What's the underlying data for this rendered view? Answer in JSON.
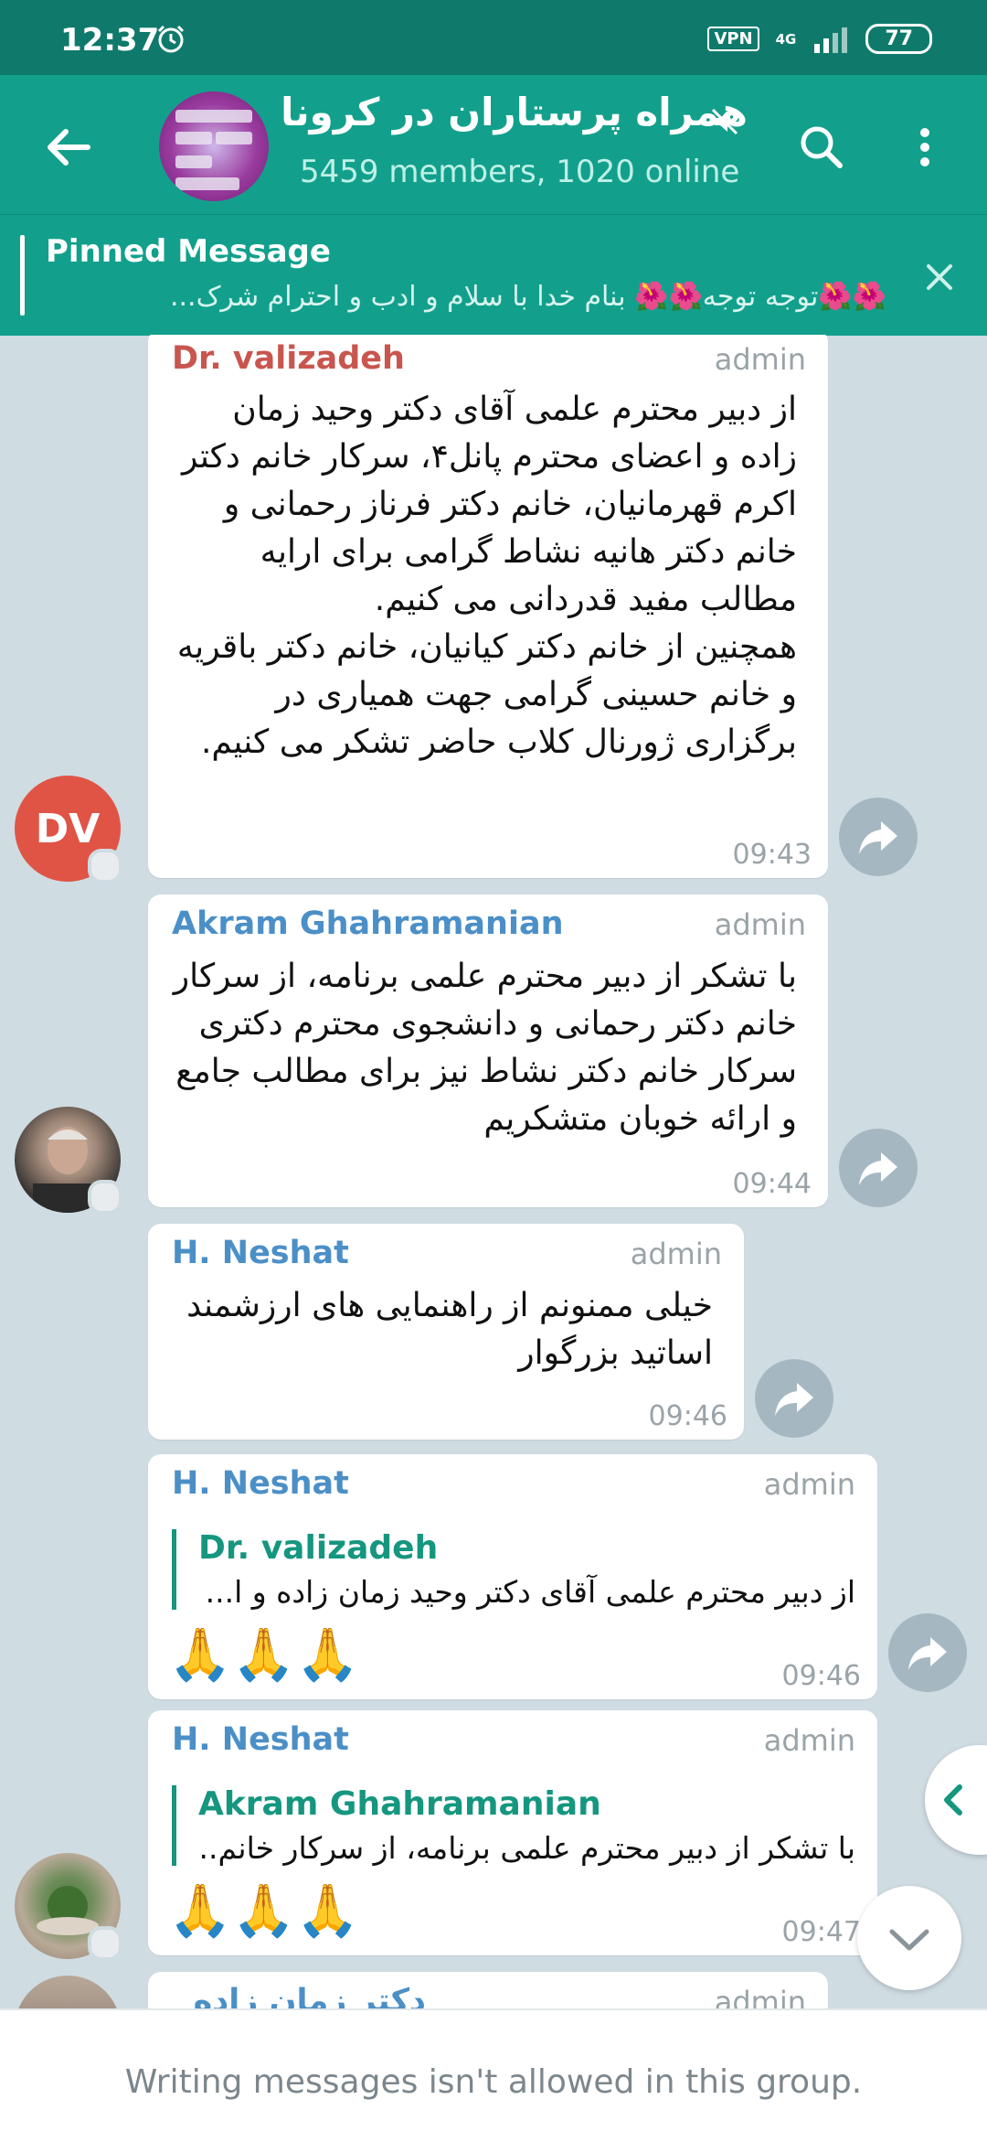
{
  "status": {
    "time": "12:37",
    "vpn": "VPN",
    "network": "4G",
    "battery": "77"
  },
  "header": {
    "title": "همراه پرستاران در کرونا",
    "subtitle": "5459 members, 1020 online"
  },
  "pinned": {
    "label": "Pinned Message",
    "text": "🌺🌺توجه توجه🌺🌺  بنام خدا  با سلام و ادب و احترام  شرک..."
  },
  "messages": [
    {
      "sender": "Dr. valizadeh",
      "role": "admin",
      "text": "از دبیر محترم علمی آقای دکتر وحید زمان زاده و اعضای محترم پانل۴، سرکار خانم دکتر اکرم قهرمانیان، خانم دکتر فرناز رحمانی و خانم دکتر هانیه نشاط گرامی برای ارایه مطالب مفید قدردانی می کنیم.\nهمچنین از خانم دکتر کیانیان، خانم دکتر باقریه و خانم حسینی گرامی جهت همیاری در برگزاری ژورنال کلاب حاضر تشکر می کنیم.",
      "time": "09:43",
      "avatar_initials": "DV"
    },
    {
      "sender": "Akram Ghahramanian",
      "role": "admin",
      "text": "با تشکر از دبیر محترم علمی برنامه، از سرکار خانم دکتر رحمانی و دانشجوی محترم دکتری سرکار خانم دکتر نشاط نیز برای مطالب جامع و ارائه خوبان متشکریم",
      "time": "09:44"
    },
    {
      "sender": "H. Neshat",
      "role": "admin",
      "text": "خیلی ممنونم از راهنمایی های ارزشمند اساتید بزرگوار",
      "time": "09:46"
    },
    {
      "sender": "H. Neshat",
      "role": "admin",
      "reply_name": "Dr. valizadeh",
      "reply_text": "از دبیر محترم علمی آقای دکتر وحید زمان زاده و ا...",
      "text": "🙏🙏🙏",
      "time": "09:46"
    },
    {
      "sender": "H. Neshat",
      "role": "admin",
      "reply_name": "Akram Ghahramanian",
      "reply_text": "با تشکر از دبیر محترم علمی برنامه، از سرکار خانم...",
      "text": "🙏🙏🙏",
      "time": "09:47"
    },
    {
      "sender": "دکتر زمان زاده",
      "role": "admin"
    }
  ],
  "footer": {
    "text": "Writing messages isn't allowed in this group."
  },
  "colors": {
    "header": "#12a08c",
    "statusbar": "#0f7a6c",
    "chat_bg": "#cfdce2",
    "accent": "#15967f"
  }
}
